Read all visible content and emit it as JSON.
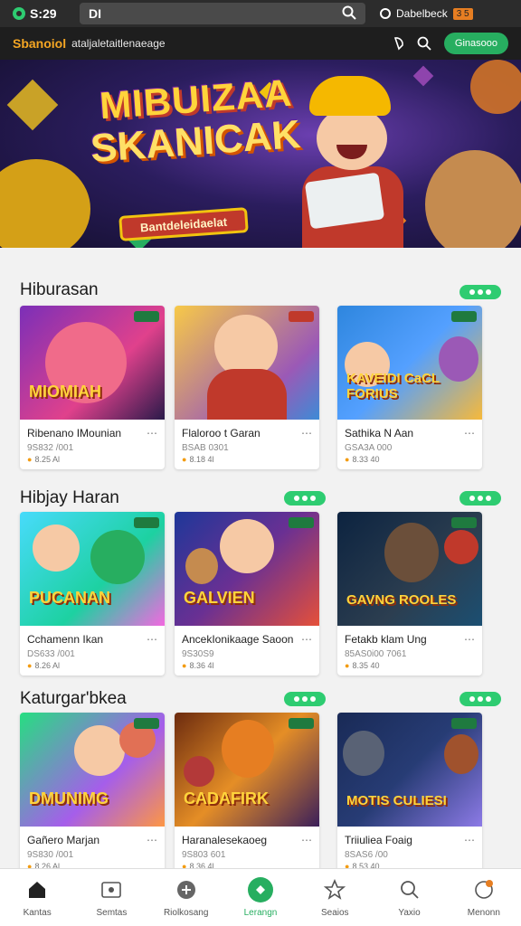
{
  "status": {
    "time": "S:29",
    "battery": "3 5"
  },
  "urlbar": {
    "text": "DI"
  },
  "status_right": {
    "label": "Dabelbeck"
  },
  "header": {
    "brand": "Sbanoiol",
    "subtitle": "ataljaletaitlenaeage",
    "cta": "Ginasooo"
  },
  "banner": {
    "title_line1": "MIBUIZAA",
    "title_line2": "SKANICAK",
    "ribbon": "Bantdeleidaelat"
  },
  "sections": [
    {
      "title": "Hiburasan",
      "cards": [
        {
          "thumb": "MIOMIAH",
          "name": "Ribenano IMounian",
          "sub": "9S832 /001",
          "rating": "8.25 Al"
        },
        {
          "thumb": "",
          "name": "Flaloroo t Garan",
          "sub": "BSAB 0301",
          "rating": "8.18 4l"
        },
        {
          "thumb": "KAVEIDI CaCL FORIUS",
          "name": "Sathika N Aan",
          "sub": "GSA3A 000",
          "rating": "8.33 40"
        }
      ]
    },
    {
      "title": "Hibjay Haran",
      "cards": [
        {
          "thumb": "PUCANAN",
          "name": "Cchamenn Ikan",
          "sub": "DS633 /001",
          "rating": "8.26 Al"
        },
        {
          "thumb": "GALVIEN",
          "name": "AncekIonikaage Saoon",
          "sub": "9S30S9",
          "rating": "8.36 4l"
        },
        {
          "thumb": "GAVNG ROOLES",
          "name": "Fetakb klam Ung",
          "sub": "85AS0i00 7061",
          "rating": "8.35 40"
        }
      ]
    },
    {
      "title": "Katurgar'bkea",
      "cards": [
        {
          "thumb": "DMUNIMG",
          "name": "Gañero Marjan",
          "sub": "9S830 /001",
          "rating": "8.26 Al"
        },
        {
          "thumb": "CADAFIRK",
          "name": "Haranalesekaoeg",
          "sub": "9S803 601",
          "rating": "8.36 4l"
        },
        {
          "thumb": "MOTIS CULIESI",
          "name": "Triiuliea Foaig",
          "sub": "8SAS6 /00",
          "rating": "8.53 40"
        }
      ]
    }
  ],
  "bottom_nav": [
    {
      "label": "Kantas"
    },
    {
      "label": "Semtas"
    },
    {
      "label": "Riolkosang"
    },
    {
      "label": "Lerangn"
    },
    {
      "label": "Seaios"
    },
    {
      "label": "Yaxio"
    },
    {
      "label": "Menonn"
    }
  ],
  "colors": {
    "accent": "#27ae60",
    "brand": "#f5a623",
    "dark": "#1e1e1e"
  }
}
